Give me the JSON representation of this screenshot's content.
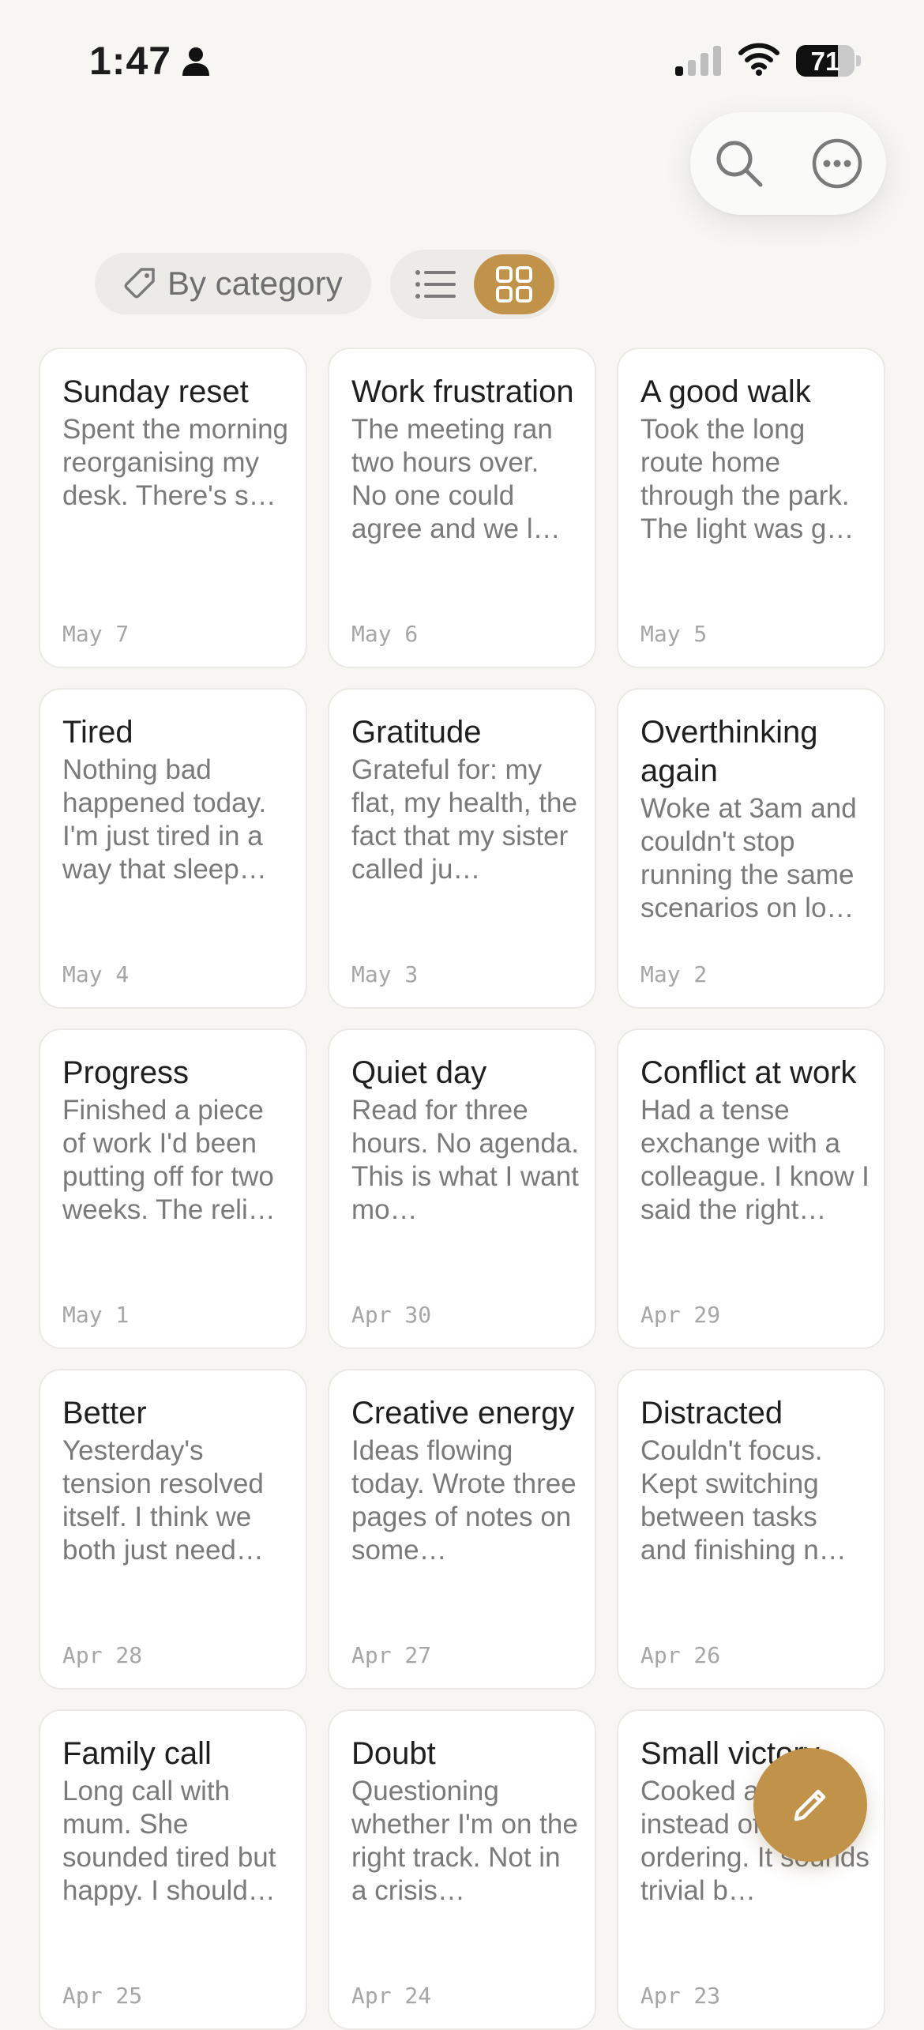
{
  "status_bar": {
    "time": "1:47",
    "battery": "71",
    "battery_level": 0.71
  },
  "toolbar": {
    "search_icon": "search-icon",
    "more_icon": "ellipsis-circle-icon"
  },
  "filters": {
    "category_label": "By category",
    "views": [
      {
        "name": "list",
        "icon": "list-icon",
        "selected": false
      },
      {
        "name": "grid",
        "icon": "grid-icon",
        "selected": true
      }
    ]
  },
  "accent_color": "#c0924a",
  "entries": [
    {
      "title": "Sunday reset",
      "excerpt": "Spent the morning reorganising my desk. There's s…",
      "date": "May 7"
    },
    {
      "title": "Work frustration",
      "excerpt": "The meeting ran two hours over. No one could agree and we l…",
      "date": "May 6"
    },
    {
      "title": "A good walk",
      "excerpt": "Took the long route home through the park. The light was g…",
      "date": "May 5"
    },
    {
      "title": "Tired",
      "excerpt": "Nothing bad happened today. I'm just tired in a way that sleep…",
      "date": "May 4"
    },
    {
      "title": "Gratitude",
      "excerpt": "Grateful for: my flat, my health, the fact that my sister called ju…",
      "date": "May 3"
    },
    {
      "title": "Overthinking again",
      "excerpt": "Woke at 3am and couldn't stop running the same scenarios on lo…",
      "date": "May 2"
    },
    {
      "title": "Progress",
      "excerpt": "Finished a piece of work I'd been putting off for two weeks. The reli…",
      "date": "May 1"
    },
    {
      "title": "Quiet day",
      "excerpt": "Read for three hours. No agenda. This is what I want mo…",
      "date": "Apr 30"
    },
    {
      "title": "Conflict at work",
      "excerpt": "Had a tense exchange with a colleague. I know I said the right…",
      "date": "Apr 29"
    },
    {
      "title": "Better",
      "excerpt": "Yesterday's tension resolved itself. I think we both just need…",
      "date": "Apr 28"
    },
    {
      "title": "Creative energy",
      "excerpt": "Ideas flowing today. Wrote three pages of notes on some…",
      "date": "Apr 27"
    },
    {
      "title": "Distracted",
      "excerpt": "Couldn't focus. Kept switching between tasks and finishing n…",
      "date": "Apr 26"
    },
    {
      "title": "Family call",
      "excerpt": "Long call with mum. She sounded tired but happy. I should…",
      "date": "Apr 25"
    },
    {
      "title": "Doubt",
      "excerpt": "Questioning whether I'm on the right track. Not in a crisis…",
      "date": "Apr 24"
    },
    {
      "title": "Small victory",
      "excerpt": "Cooked a meal instead of ordering. It sounds trivial b…",
      "date": "Apr 23"
    }
  ],
  "fab": {
    "icon": "pencil-icon"
  }
}
